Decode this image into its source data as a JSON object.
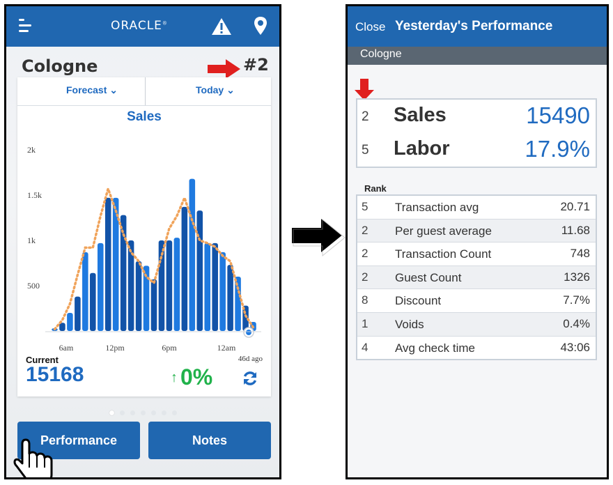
{
  "left_screen": {
    "header": {
      "brand": "ORACLE",
      "menu_icon": "hamburger-menu-icon",
      "alert_icon": "warning-icon",
      "location_icon": "map-pin-icon"
    },
    "location": "Cologne",
    "rank": "#2",
    "card": {
      "dropdown_left": "Forecast",
      "dropdown_right": "Today",
      "chart_title": "Sales",
      "current_label": "Current",
      "current_value": "15168",
      "ago_label": "46d ago",
      "change": "0%",
      "change_color": "#21b24b"
    },
    "pager": {
      "count": 7,
      "active": 0
    },
    "buttons": {
      "performance": "Performance",
      "notes": "Notes"
    }
  },
  "chart_data": {
    "type": "bar",
    "title": "Sales",
    "xlabel": "",
    "ylabel": "",
    "y_ticks": [
      "2k",
      "1.5k",
      "1k",
      "500"
    ],
    "ylim": [
      0,
      2300
    ],
    "x_tick_labels": [
      "6am",
      "12pm",
      "6pm",
      "12am"
    ],
    "grid": false,
    "series": [
      {
        "values": [
          30,
          90,
          200,
          380,
          870,
          640,
          970,
          1470,
          1470,
          1280,
          1000,
          770,
          720,
          570,
          1000,
          1000,
          1030,
          1370,
          1680,
          1330,
          970,
          970,
          870,
          730,
          600,
          280,
          100
        ]
      },
      {
        "values": [
          20,
          120,
          300,
          620,
          920,
          920,
          1270,
          1570,
          1330,
          1070,
          870,
          770,
          600,
          530,
          830,
          1130,
          1270,
          1470,
          1220,
          1000,
          970,
          930,
          830,
          770,
          470,
          170,
          40
        ]
      }
    ],
    "colors": {
      "bars_light": "#1f7ae0",
      "bars_dark": "#1253a8",
      "forecast": "#f0a35a"
    }
  },
  "right_screen": {
    "header": {
      "close": "Close",
      "title": "Yesterday's Performance"
    },
    "location": "Cologne",
    "primary_metrics": [
      {
        "rank": "2",
        "label": "Sales",
        "value": "15490"
      },
      {
        "rank": "5",
        "label": "Labor",
        "value": "17.9%"
      }
    ],
    "rank_heading": "Rank",
    "metrics": [
      {
        "rank": "5",
        "label": "Transaction avg",
        "value": "20.71"
      },
      {
        "rank": "2",
        "label": "Per guest average",
        "value": "11.68"
      },
      {
        "rank": "2",
        "label": "Transaction Count",
        "value": "748"
      },
      {
        "rank": "2",
        "label": "Guest Count",
        "value": "1326"
      },
      {
        "rank": "8",
        "label": "Discount",
        "value": "7.7%"
      },
      {
        "rank": "1",
        "label": "Voids",
        "value": "0.4%"
      },
      {
        "rank": "4",
        "label": "Avg check time",
        "value": "43:06"
      }
    ]
  }
}
